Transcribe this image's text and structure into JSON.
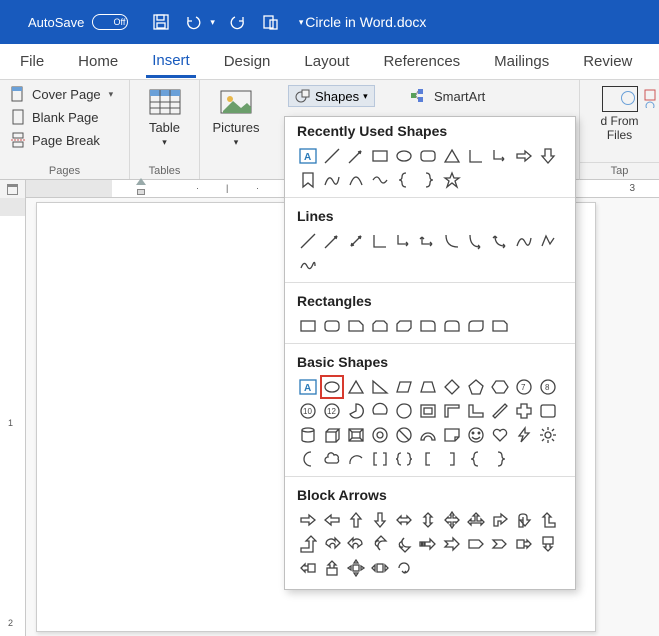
{
  "titlebar": {
    "autosave_label": "AutoSave",
    "autosave_state": "Off",
    "doc_title": "Circle in Word.docx"
  },
  "tabs": [
    "File",
    "Home",
    "Insert",
    "Design",
    "Layout",
    "References",
    "Mailings",
    "Review"
  ],
  "active_tab_index": 2,
  "ribbon": {
    "pages": {
      "label": "Pages",
      "cover_page": "Cover Page",
      "blank_page": "Blank Page",
      "page_break": "Page Break"
    },
    "tables": {
      "label": "Tables",
      "btn": "Table"
    },
    "illustrations": {
      "pictures": "Pictures",
      "shapes": "Shapes",
      "smartart": "SmartArt"
    },
    "right": {
      "line1": "d From",
      "line2": "Files",
      "group_label": "Tap"
    }
  },
  "ruler": {
    "num_right": "3"
  },
  "vruler": {
    "n1": "1",
    "n2": "2"
  },
  "shapes_panel": {
    "sections": {
      "recent": "Recently Used Shapes",
      "lines": "Lines",
      "rects": "Rectangles",
      "basic": "Basic Shapes",
      "arrows": "Block Arrows"
    },
    "basic_numbers": [
      "7",
      "8",
      "10",
      "12"
    ]
  }
}
